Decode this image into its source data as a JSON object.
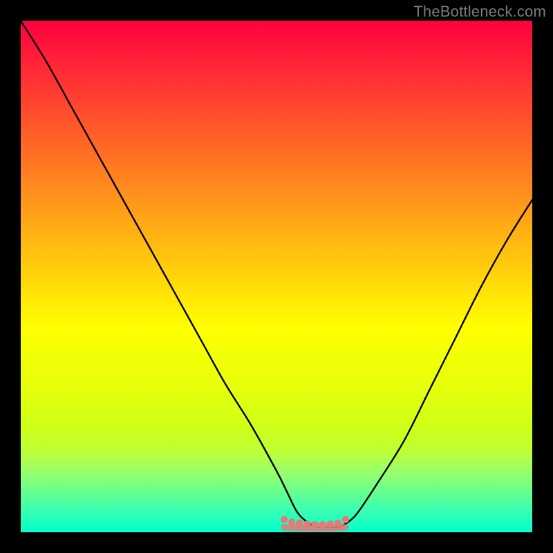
{
  "watermark": "TheBottleneck.com",
  "colors": {
    "background": "#000000",
    "curve": "#000000",
    "marker": "#e47a7a",
    "gradient_top": "#ff0040",
    "gradient_bottom": "#00ffcc"
  },
  "chart_data": {
    "type": "line",
    "title": "",
    "xlabel": "",
    "ylabel": "",
    "xlim": [
      0,
      100
    ],
    "ylim": [
      0,
      100
    ],
    "series": [
      {
        "name": "bottleneck-curve",
        "x": [
          0,
          5,
          10,
          15,
          20,
          25,
          30,
          35,
          40,
          45,
          50,
          52,
          54,
          56,
          58,
          60,
          62,
          64,
          66,
          70,
          75,
          80,
          85,
          90,
          95,
          100
        ],
        "values": [
          100,
          92,
          83,
          74,
          65,
          56,
          47,
          38,
          29,
          21,
          12,
          8,
          4,
          2,
          1,
          1,
          1,
          2,
          4,
          10,
          18,
          28,
          38,
          48,
          57,
          65
        ]
      }
    ],
    "markers": {
      "name": "flat-region-dots",
      "x": [
        51.5,
        53,
        54.5,
        56,
        57.5,
        59,
        60.5,
        62,
        63.5
      ],
      "values": [
        2.5,
        2,
        1.8,
        1.6,
        1.5,
        1.5,
        1.6,
        1.8,
        2.5
      ]
    },
    "annotations": []
  }
}
